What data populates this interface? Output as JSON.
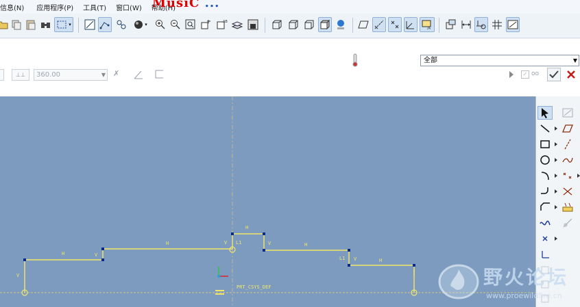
{
  "menubar": {
    "items": [
      "信息(N)",
      "应用程序(P)",
      "工具(T)",
      "窗口(W)",
      "帮助(H)"
    ],
    "overlay_word": "MusiC",
    "overlay_dots": "..."
  },
  "toolbar": {
    "icons": [
      "folder-open",
      "copy",
      "paste",
      "find",
      "select-box",
      "repaint",
      "sketch-view",
      "datum-display",
      "spin-center",
      "shade-sphere",
      "zoom-in",
      "zoom-out",
      "refit",
      "named-view",
      "layers",
      "display-style-save",
      "wireframe",
      "hidden-line",
      "no-hidden",
      "shaded",
      "appearance",
      "plane-display",
      "axis-display",
      "point-display",
      "csys-display",
      "annotation",
      "sketch-constraints",
      "dimension-display",
      "grid-display",
      "sketch-orient"
    ]
  },
  "filter": {
    "selected": "全部"
  },
  "dimension_bar": {
    "angle_value": "360.00"
  },
  "sketch": {
    "labels": {
      "v_left": "V",
      "h_first": "H",
      "v_step1": "V",
      "h_middle_left": "H",
      "v_center": "V",
      "l1_a": "L1",
      "h_top": "H",
      "v_right_top": "V",
      "h_middle_right": "H",
      "l1_b": "L1",
      "v_step2": "V",
      "h_last": "H",
      "csys": "PRT_CSYS_DEF"
    }
  },
  "watermark": {
    "title": "野火论坛",
    "url": "www.proewildfire.cn"
  },
  "colors": {
    "canvas": "#7c9bbf",
    "sketch_line": "#f1e86a",
    "vertex": "#0a2a8a",
    "centerline": "#c9b58a"
  }
}
